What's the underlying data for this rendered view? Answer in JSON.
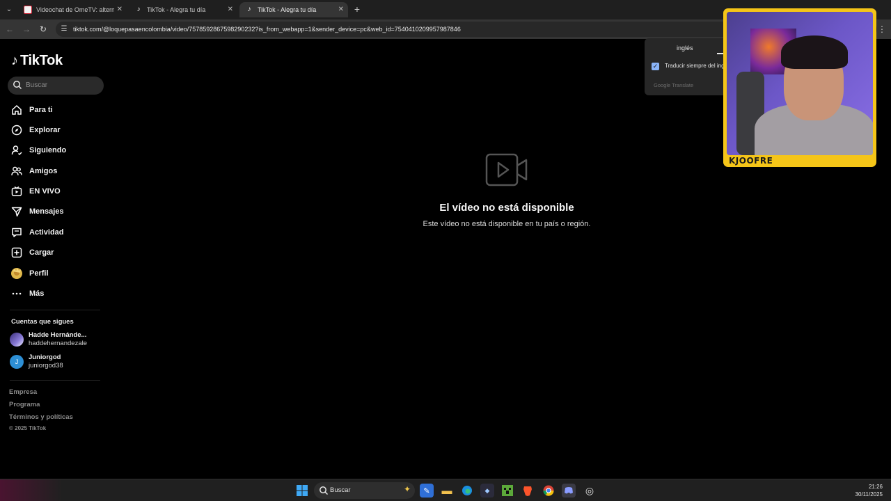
{
  "browser": {
    "tabs": [
      {
        "label": "Videochat de OmeTV: alternati...",
        "active": false,
        "favicon": "ometv-icon"
      },
      {
        "label": "TikTok - Alegra tu día",
        "active": false,
        "favicon": "tiktok-icon"
      },
      {
        "label": "TikTok - Alegra tu día",
        "active": true,
        "favicon": "tiktok-icon"
      }
    ],
    "new_tab": "+",
    "url": "tiktok.com/@loquepasaencolombia/video/7578592867598290232?is_from_webapp=1&sender_device=pc&web_id=7540410209957987846"
  },
  "sidebar": {
    "brand": "TikTok",
    "search_placeholder": "Buscar",
    "nav": [
      {
        "label": "Para ti",
        "icon": "home-icon"
      },
      {
        "label": "Explorar",
        "icon": "compass-icon"
      },
      {
        "label": "Siguiendo",
        "icon": "following-icon"
      },
      {
        "label": "Amigos",
        "icon": "friends-icon"
      },
      {
        "label": "EN VIVO",
        "icon": "live-icon"
      },
      {
        "label": "Mensajes",
        "icon": "messages-icon"
      },
      {
        "label": "Actividad",
        "icon": "activity-icon"
      },
      {
        "label": "Cargar",
        "icon": "upload-icon"
      },
      {
        "label": "Perfil",
        "icon": "profile-avatar-icon"
      },
      {
        "label": "Más",
        "icon": "more-icon"
      }
    ],
    "following_title": "Cuentas que sigues",
    "following": [
      {
        "name": "Hadde Hernánde...",
        "handle": "haddehernandezale",
        "avatar_color": "#6a5acd"
      },
      {
        "name": "Juniorgod",
        "handle": "juniorgod38",
        "avatar_initial": "J",
        "avatar_color": "#2d8fd5"
      }
    ],
    "footer": [
      "Empresa",
      "Programa",
      "Términos y políticas"
    ],
    "copyright": "© 2025 TikTok"
  },
  "main": {
    "title": "El vídeo no está disponible",
    "subtitle": "Este vídeo no está disponible en tu país o región."
  },
  "translate": {
    "tab_label": "inglés",
    "checkbox_label": "Traducir siempre del ing",
    "checked": true,
    "brand": "Google Translate"
  },
  "webcam": {
    "name_tag": "KJOOFRE",
    "frame_color": "#f5c518"
  },
  "taskbar": {
    "search_placeholder": "Buscar",
    "time": "21:26",
    "date": "30/11/2025"
  }
}
